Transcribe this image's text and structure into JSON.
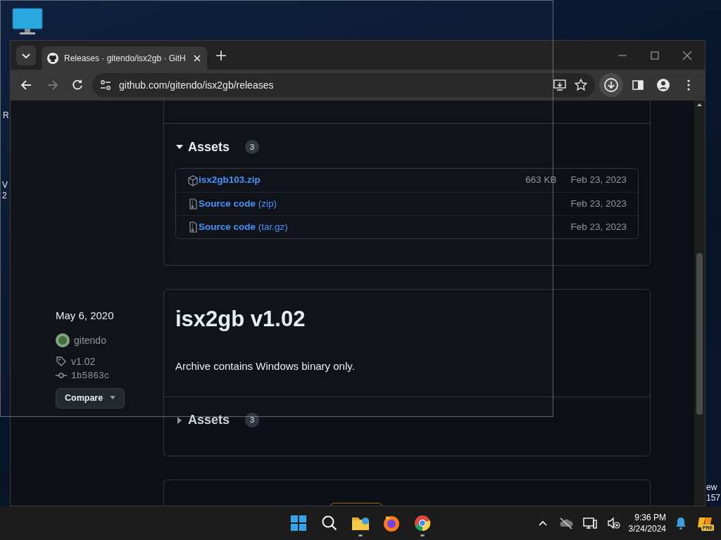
{
  "desktop": {
    "label_fragments": [
      {
        "text": "R"
      },
      {
        "text": "V"
      },
      {
        "text": "2"
      },
      {
        "text": "ew"
      },
      {
        "text": "157"
      }
    ]
  },
  "browser": {
    "tabs": [
      {
        "title": "Releases · gitendo/isx2gb · GitH",
        "selected": true
      }
    ],
    "url": "github.com/gitendo/isx2gb/releases"
  },
  "releases": [
    {
      "cut_top": true,
      "assets_label": "Assets",
      "asset_count": "3",
      "assets_expanded": true,
      "assets": [
        {
          "kind": "package",
          "name": "isx2gb103.zip",
          "size": "663 KB",
          "date": "Feb 23, 2023"
        },
        {
          "kind": "source",
          "name": "**Source code** (zip)",
          "date": "Feb 23, 2023"
        },
        {
          "kind": "source",
          "name": "**Source code** (tar.gz)",
          "date": "Feb 23, 2023"
        }
      ]
    },
    {
      "date": "May 6, 2020",
      "author": "gitendo",
      "tag": "v1.02",
      "commit": "1b5863c",
      "compare": "Compare",
      "title": "isx2gb v1.02",
      "body": "Archive contains Windows binary only.",
      "assets_label": "Assets",
      "asset_count": "3",
      "assets_expanded": false
    },
    {
      "has_label": true
    }
  ],
  "taskbar": {
    "apps": [
      {
        "kind": "start",
        "running": false
      },
      {
        "kind": "search",
        "running": false
      },
      {
        "kind": "explorer",
        "running": true
      },
      {
        "kind": "firefox",
        "running": false
      },
      {
        "kind": "chrome",
        "running": true
      }
    ],
    "time": "9:36 PM",
    "date": "3/24/2024",
    "copilot_badge": "PRE"
  }
}
